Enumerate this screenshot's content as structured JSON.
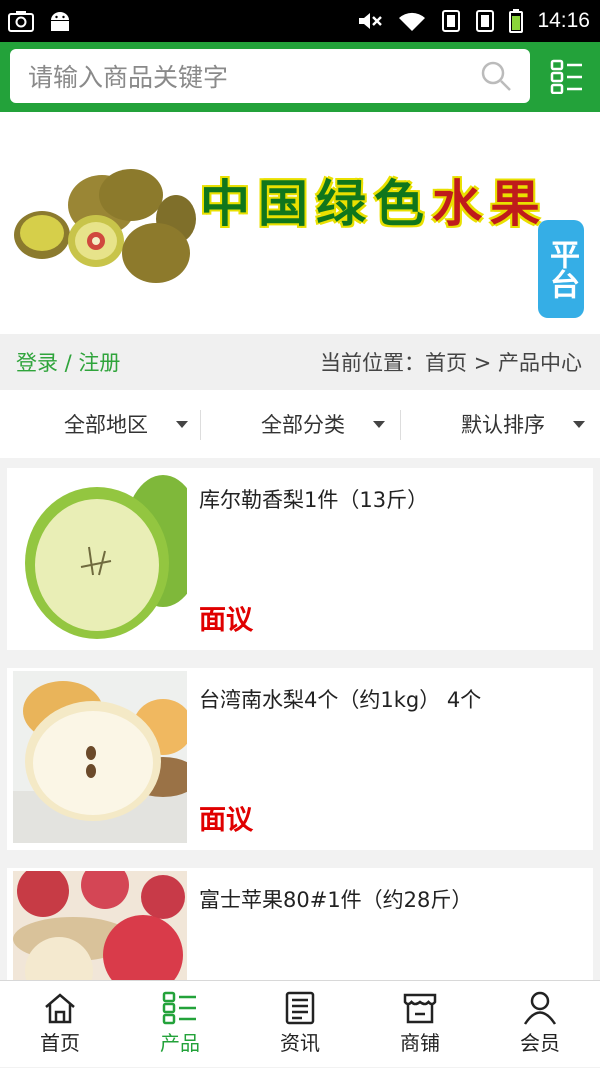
{
  "status_bar": {
    "time": "14:16"
  },
  "search": {
    "placeholder": "请输入商品关键字"
  },
  "banner": {
    "title_parts": [
      "中",
      "国",
      "绿",
      "色",
      "水",
      "果"
    ],
    "tag": "平台"
  },
  "user_bar": {
    "login_label": "登录 / 注册",
    "breadcrumb": "当前位置：首页 > 产品中心"
  },
  "filters": [
    {
      "label": "全部地区"
    },
    {
      "label": "全部分类"
    },
    {
      "label": "默认排序"
    }
  ],
  "products": [
    {
      "name": "库尔勒香梨1件（13斤）",
      "price": "面议"
    },
    {
      "name": "台湾南水梨4个（约1kg）  4个",
      "price": "面议"
    },
    {
      "name": "富士苹果80#1件（约28斤）",
      "price": ""
    }
  ],
  "bottom_nav": [
    {
      "label": "首页",
      "icon": "home-icon"
    },
    {
      "label": "产品",
      "icon": "list-icon",
      "active": true
    },
    {
      "label": "资讯",
      "icon": "news-icon"
    },
    {
      "label": "商铺",
      "icon": "store-icon"
    },
    {
      "label": "会员",
      "icon": "user-icon"
    }
  ],
  "colors": {
    "brand_green": "#23a23a",
    "price_red": "#e00000",
    "tag_blue": "#35aee6"
  }
}
